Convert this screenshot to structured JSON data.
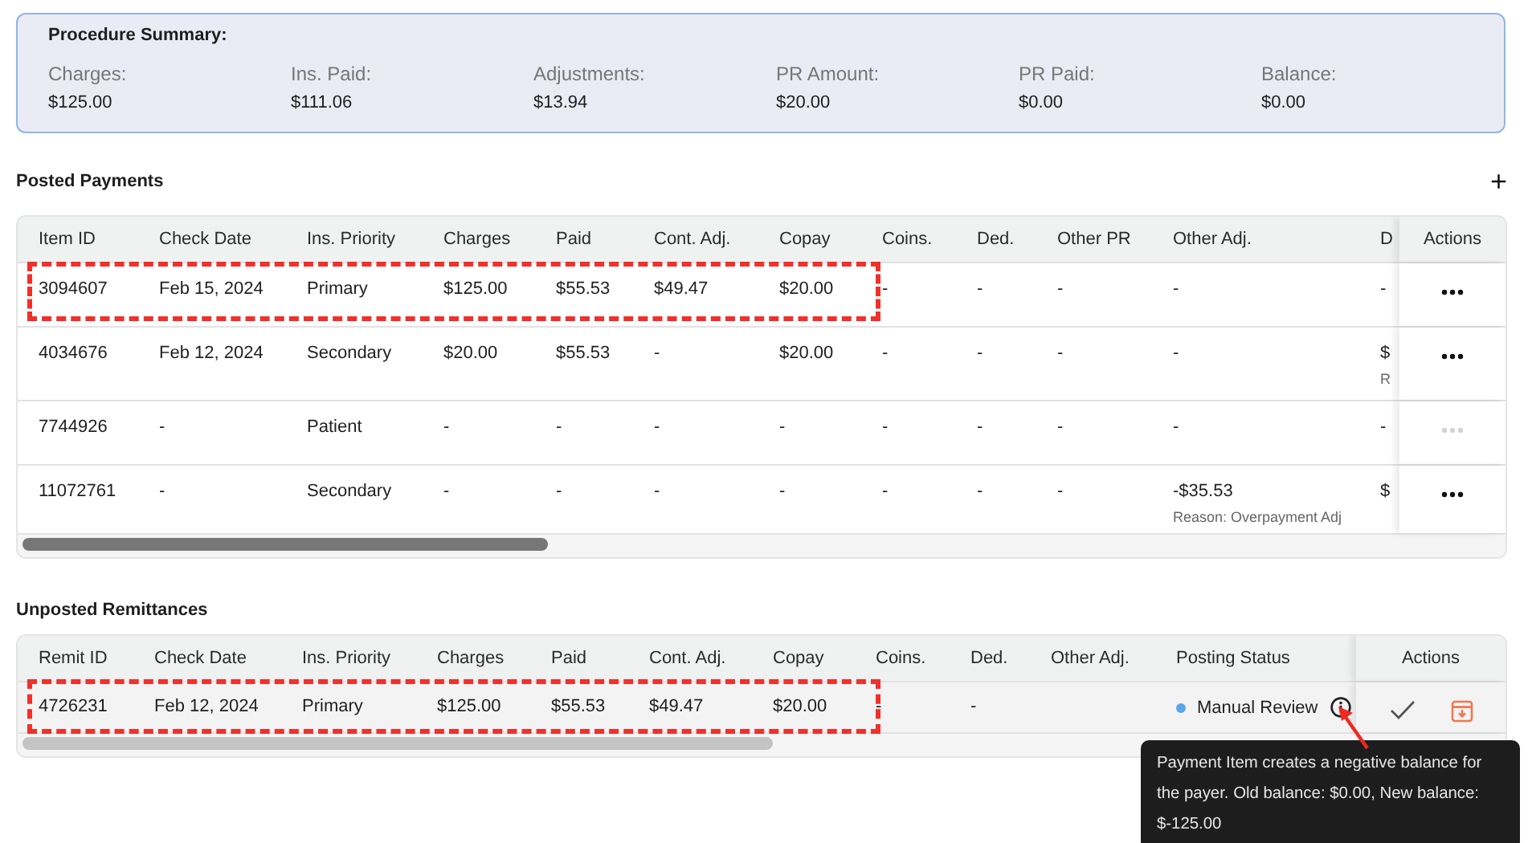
{
  "summary": {
    "title": "Procedure Summary:",
    "items": [
      {
        "label": "Charges:",
        "value": "$125.00"
      },
      {
        "label": "Ins. Paid:",
        "value": "$111.06"
      },
      {
        "label": "Adjustments:",
        "value": "$13.94"
      },
      {
        "label": "PR Amount:",
        "value": "$20.00"
      },
      {
        "label": "PR Paid:",
        "value": "$0.00"
      },
      {
        "label": "Balance:",
        "value": "$0.00"
      }
    ]
  },
  "posted": {
    "title": "Posted Payments",
    "add_label": "+",
    "columns": [
      "Item ID",
      "Check Date",
      "Ins. Priority",
      "Charges",
      "Paid",
      "Cont. Adj.",
      "Copay",
      "Coins.",
      "Ded.",
      "Other PR",
      "Other Adj.",
      "D"
    ],
    "actions_header": "Actions",
    "rows": [
      {
        "highlighted": true,
        "actions_disabled": false,
        "cells": [
          "3094607",
          "Feb 15, 2024",
          "Primary",
          "$125.00",
          "$55.53",
          "$49.47",
          "$20.00",
          "-",
          "-",
          "-",
          "-",
          "-"
        ]
      },
      {
        "highlighted": false,
        "actions_disabled": false,
        "cells": [
          "4034676",
          "Feb 12, 2024",
          "Secondary",
          "$20.00",
          "$55.53",
          "-",
          "$20.00",
          "-",
          "-",
          "-",
          "-",
          {
            "text": "$",
            "note": "R"
          }
        ]
      },
      {
        "highlighted": false,
        "actions_disabled": true,
        "cells": [
          "7744926",
          "-",
          "Patient",
          "-",
          "-",
          "-",
          "-",
          "-",
          "-",
          "-",
          "-",
          "-"
        ]
      },
      {
        "highlighted": false,
        "actions_disabled": false,
        "cells": [
          "11072761",
          "-",
          "Secondary",
          "-",
          "-",
          "-",
          "-",
          "-",
          "-",
          "-",
          {
            "text": "-$35.53",
            "note": "Reason: Overpayment Adj"
          },
          "$"
        ]
      }
    ]
  },
  "unposted": {
    "title": "Unposted Remittances",
    "columns": [
      "Remit ID",
      "Check Date",
      "Ins. Priority",
      "Charges",
      "Paid",
      "Cont. Adj.",
      "Copay",
      "Coins.",
      "Ded.",
      "Other Adj.",
      "Posting Status"
    ],
    "actions_header": "Actions",
    "rows": [
      {
        "highlighted": true,
        "cells": [
          "4726231",
          "Feb 12, 2024",
          "Primary",
          "$125.00",
          "$55.53",
          "$49.47",
          "$20.00",
          "-",
          "-"
        ],
        "status": {
          "label": "Manual Review",
          "color": "#5aa6e8",
          "tooltip": "Payment Item creates a negative balance for the payer. Old balance: $0.00, New balance: $-125.00"
        }
      }
    ]
  }
}
